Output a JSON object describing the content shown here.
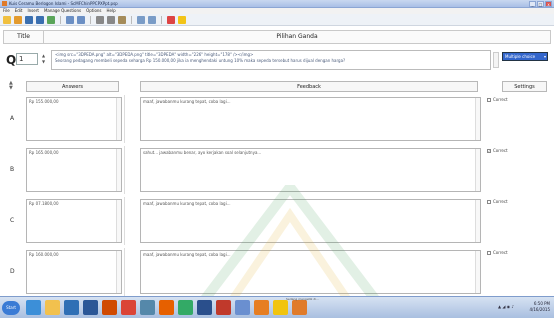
{
  "window": {
    "title": "Kuis Ceramu Berlogon Islami - ScMFChinPPCPXPpt.psp",
    "controls": [
      "_",
      "□",
      "x"
    ]
  },
  "menubar": [
    "File",
    "Edit",
    "Insert",
    "Manage Questions",
    "Options",
    "Help"
  ],
  "toolbar": {
    "icons": [
      {
        "name": "new-icon",
        "color": "#f0c040"
      },
      {
        "name": "open-icon",
        "color": "#e39b2f"
      },
      {
        "name": "save-icon",
        "color": "#3a6fb0"
      },
      {
        "name": "save-all-icon",
        "color": "#3a6fb0"
      },
      {
        "name": "preview-icon",
        "color": "#5aa55a"
      },
      {
        "name": "undo-icon",
        "color": "#6b8fc4"
      },
      {
        "name": "redo-icon",
        "color": "#6b8fc4"
      },
      {
        "name": "cut-icon",
        "color": "#888888"
      },
      {
        "name": "copy-icon",
        "color": "#888888"
      },
      {
        "name": "paste-icon",
        "color": "#a58c5a"
      },
      {
        "name": "image-icon",
        "color": "#7a9cc7"
      },
      {
        "name": "media-icon",
        "color": "#7a9cc7"
      },
      {
        "name": "flag-icon",
        "color": "#d44"
      },
      {
        "name": "bulb-icon",
        "color": "#f2c418"
      }
    ]
  },
  "title_row": {
    "label": "Title",
    "value": "Pilihan Ganda"
  },
  "question": {
    "label": "Q",
    "number": "1",
    "text_line1": "<img src=\"3DPEDA.png\" alt=\"3DPEDA.png\" title=\"3DPEDA\" width=\"226\" height=\"178\" /></img>",
    "text_line2": "Seorang pedagang membeli sepeda seharga Rp 150.000,00 jika ia menghendaki untung 10% maka sepeda tersebut harus dijual dengan harga?",
    "type": "Multiple choice"
  },
  "columns": {
    "answers": "Answers",
    "feedback": "Feedback",
    "settings": "Settings"
  },
  "answers": [
    {
      "letter": "A",
      "answer": "Rp 155.000,00",
      "feedback": "maaf, jawabanmu kurang tepat, coba lagi...",
      "correct_label": "Correct",
      "checked": false
    },
    {
      "letter": "B",
      "answer": "Rp 165.000,00",
      "feedback": "sahut... jawabanmu benar, ayo kerjakan soal selanjutnya...",
      "correct_label": "Correct",
      "checked": true
    },
    {
      "letter": "C",
      "answer": "Rp 07.1800,00",
      "feedback": "maaf, jawabanmu kurang tepat, coba lagi...",
      "correct_label": "Correct",
      "checked": false
    },
    {
      "letter": "D",
      "answer": "Rp 160.000,00",
      "feedback": "maaf, jawabanmu kurang tepat, coba lagi...",
      "correct_label": "Correct",
      "checked": false
    }
  ],
  "taskbar": {
    "start": "Start",
    "apps": [
      {
        "name": "ie-icon",
        "color": "#3c8fd8"
      },
      {
        "name": "folder-icon",
        "color": "#f2c14e"
      },
      {
        "name": "media-player-icon",
        "color": "#2f6fb5"
      },
      {
        "name": "word-icon",
        "color": "#2b5797"
      },
      {
        "name": "powerpoint-icon",
        "color": "#d04a02"
      },
      {
        "name": "chrome-icon",
        "color": "#db4437"
      },
      {
        "name": "photos-icon",
        "color": "#58a"
      },
      {
        "name": "firefox-icon",
        "color": "#e66000"
      },
      {
        "name": "paint-icon",
        "color": "#3a6"
      },
      {
        "name": "quiz-icon",
        "color": "#2a4f8c"
      },
      {
        "name": "editor-icon",
        "color": "#c0392b"
      },
      {
        "name": "chat-icon",
        "color": "#6a8fd0"
      },
      {
        "name": "photo-icon",
        "color": "#e67e22"
      },
      {
        "name": "explorer-icon",
        "color": "#f1c40f"
      },
      {
        "name": "app-icon",
        "color": "#e07b2a"
      }
    ],
    "tooltip": "Sedang mengetik di...",
    "tray_icons": "▲ ◢ ◉ ♪",
    "time": "6:50 PM",
    "date": "4/16/2015"
  },
  "watermark_colors": {
    "green": "#3b9a52",
    "gold": "#e3b542"
  }
}
